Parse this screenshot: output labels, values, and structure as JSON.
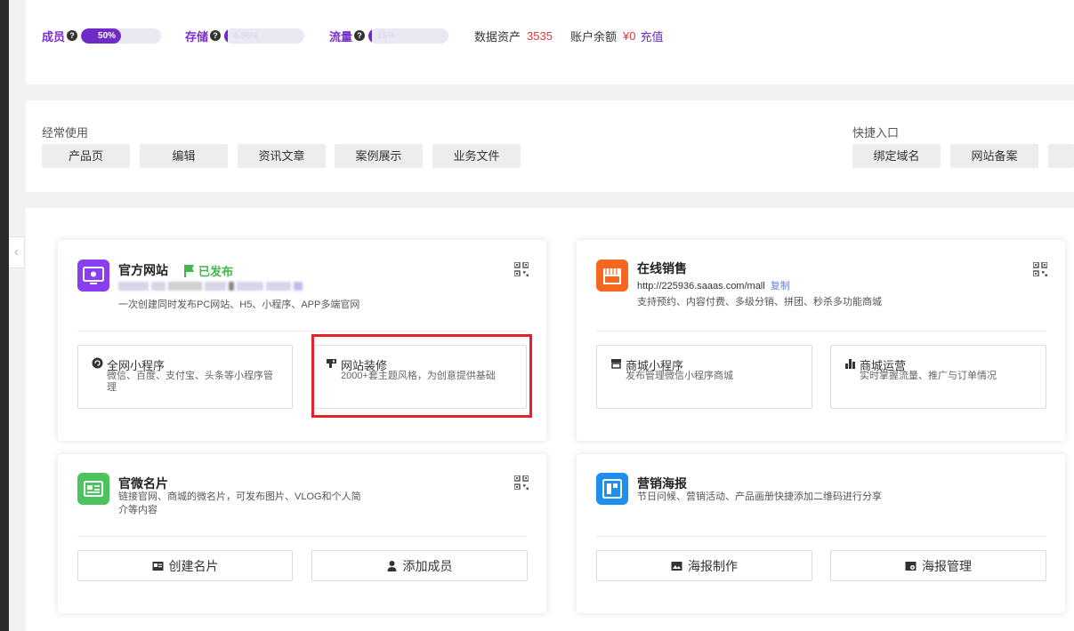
{
  "stats": {
    "members": {
      "label": "成员",
      "percent": 50,
      "text": "50%"
    },
    "storage": {
      "label": "存储",
      "percent": 4,
      "text": "4.96%"
    },
    "traffic": {
      "label": "流量",
      "percent": 4,
      "text": "15%"
    },
    "data_assets": {
      "label": "数据资产",
      "value": "3535"
    },
    "balance": {
      "label": "账户余额",
      "value": "¥0",
      "action": "充值"
    }
  },
  "frequent": {
    "title": "经常使用",
    "items": [
      "产品页",
      "编辑",
      "资讯文章",
      "案例展示",
      "业务文件"
    ]
  },
  "shortcuts": {
    "title": "快捷入口",
    "items": [
      "绑定域名",
      "网站备案"
    ]
  },
  "cards": {
    "official_site": {
      "title": "官方网站",
      "status": "已发布",
      "desc": "一次创建同时发布PC网站、H5、小程序、APP多端官网",
      "subs": [
        {
          "title": "全网小程序",
          "desc": "微信、百度、支付宝、头条等小程序管理"
        },
        {
          "title": "网站装修",
          "desc": "2000+套主题风格，为创意提供基础"
        }
      ]
    },
    "online_sales": {
      "title": "在线销售",
      "url": "http://225936.saaas.com/mall",
      "copy": "复制",
      "desc": "支持预约、内容付费、多级分销、拼团、秒杀多功能商城",
      "subs": [
        {
          "title": "商城小程序",
          "desc": "发布管理微信小程序商城"
        },
        {
          "title": "商城运营",
          "desc": "实时掌握流量、推广与订单情况"
        }
      ]
    },
    "micro_card": {
      "title": "官微名片",
      "desc": "链接官网、商城的微名片，可发布图片、VLOG和个人简介等内容",
      "buttons": [
        "创建名片",
        "添加成员"
      ]
    },
    "poster": {
      "title": "营销海报",
      "desc": "节日问候、营销活动、产品画册快捷添加二维码进行分享",
      "buttons": [
        "海报制作",
        "海报管理"
      ]
    }
  },
  "colors": {
    "accent": "#6e2bc5",
    "danger": "#e0393e",
    "published": "#3fb94a",
    "highlight": "#e3222a"
  }
}
